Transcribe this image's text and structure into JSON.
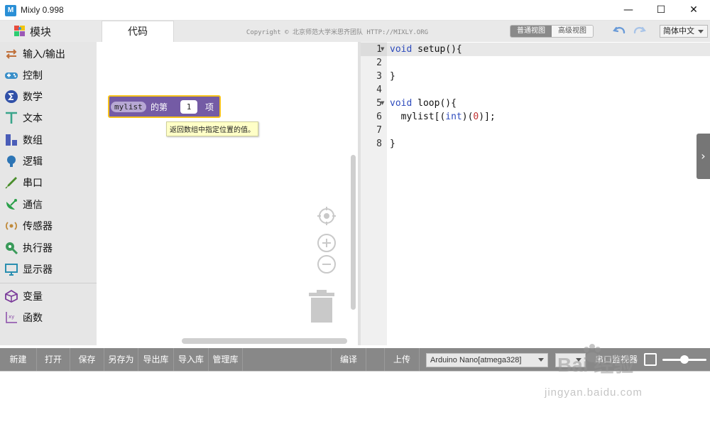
{
  "window": {
    "title": "Mixly 0.998",
    "logo_text": "M",
    "minimize": "—",
    "maximize": "☐",
    "close": "✕"
  },
  "toolbar": {
    "blocks_label": "模块",
    "code_tab": "代码",
    "copyright": "Copyright © 北京师范大学米思齐团队 HTTP://MIXLY.ORG",
    "normal_view": "普通视图",
    "advanced_view": "高级视图",
    "language": "简体中文"
  },
  "categories": [
    {
      "label": "输入/输出",
      "icon": "arrows-icon",
      "color": "#c0703a"
    },
    {
      "label": "控制",
      "icon": "gamepad-icon",
      "color": "#3a8fc9"
    },
    {
      "label": "数学",
      "icon": "sigma-icon",
      "color": "#3050a8"
    },
    {
      "label": "文本",
      "icon": "text-t-icon",
      "color": "#3aa58b"
    },
    {
      "label": "数组",
      "icon": "array-blocks-icon",
      "color": "#4a5db8"
    },
    {
      "label": "逻辑",
      "icon": "bulb-icon",
      "color": "#2d75b5"
    },
    {
      "label": "串口",
      "icon": "pen-icon",
      "color": "#4a8e2c"
    },
    {
      "label": "通信",
      "icon": "satellite-icon",
      "color": "#2aa04a"
    },
    {
      "label": "传感器",
      "icon": "sensor-icon",
      "color": "#c08a3a"
    },
    {
      "label": "执行器",
      "icon": "actuator-icon",
      "color": "#3a9a5a"
    },
    {
      "label": "显示器",
      "icon": "monitor-icon",
      "color": "#2a8fb0"
    },
    {
      "label": "变量",
      "icon": "unity-icon",
      "color": "#7a3a9a"
    },
    {
      "label": "函数",
      "icon": "function-graph-icon",
      "color": "#8a4aa8"
    }
  ],
  "workspace": {
    "block": {
      "var_name": "mylist",
      "text_before": "的第",
      "index": "1",
      "text_after": "项"
    },
    "tooltip": "返回数组中指定位置的值。"
  },
  "editor": {
    "lines": [
      {
        "n": "1",
        "fold": true
      },
      {
        "n": "2",
        "fold": false
      },
      {
        "n": "3",
        "fold": false
      },
      {
        "n": "4",
        "fold": false
      },
      {
        "n": "5",
        "fold": true
      },
      {
        "n": "6",
        "fold": false
      },
      {
        "n": "7",
        "fold": false
      },
      {
        "n": "8",
        "fold": false
      }
    ],
    "code": {
      "l1_kw": "void",
      "l1_rest": " setup(){",
      "l3": "}",
      "l5_kw": "void",
      "l5_rest": " loop(){",
      "l6_a": "  mylist[(",
      "l6_kw": "int",
      "l6_b": ")(",
      "l6_num": "0",
      "l6_c": ")];",
      "l8": "}"
    },
    "panel_toggle": "›"
  },
  "bottombar": {
    "new": "新建",
    "open": "打开",
    "save": "保存",
    "save_as": "另存为",
    "export_lib": "导出库",
    "import_lib": "导入库",
    "manage_lib": "管理库",
    "compile": "编译",
    "upload": "上传",
    "board": "Arduino Nano[atmega328]",
    "port": "",
    "serial_monitor": "串口监视器"
  },
  "watermark": {
    "big": "Bai  经验",
    "small": "jingyan.baidu.com"
  }
}
